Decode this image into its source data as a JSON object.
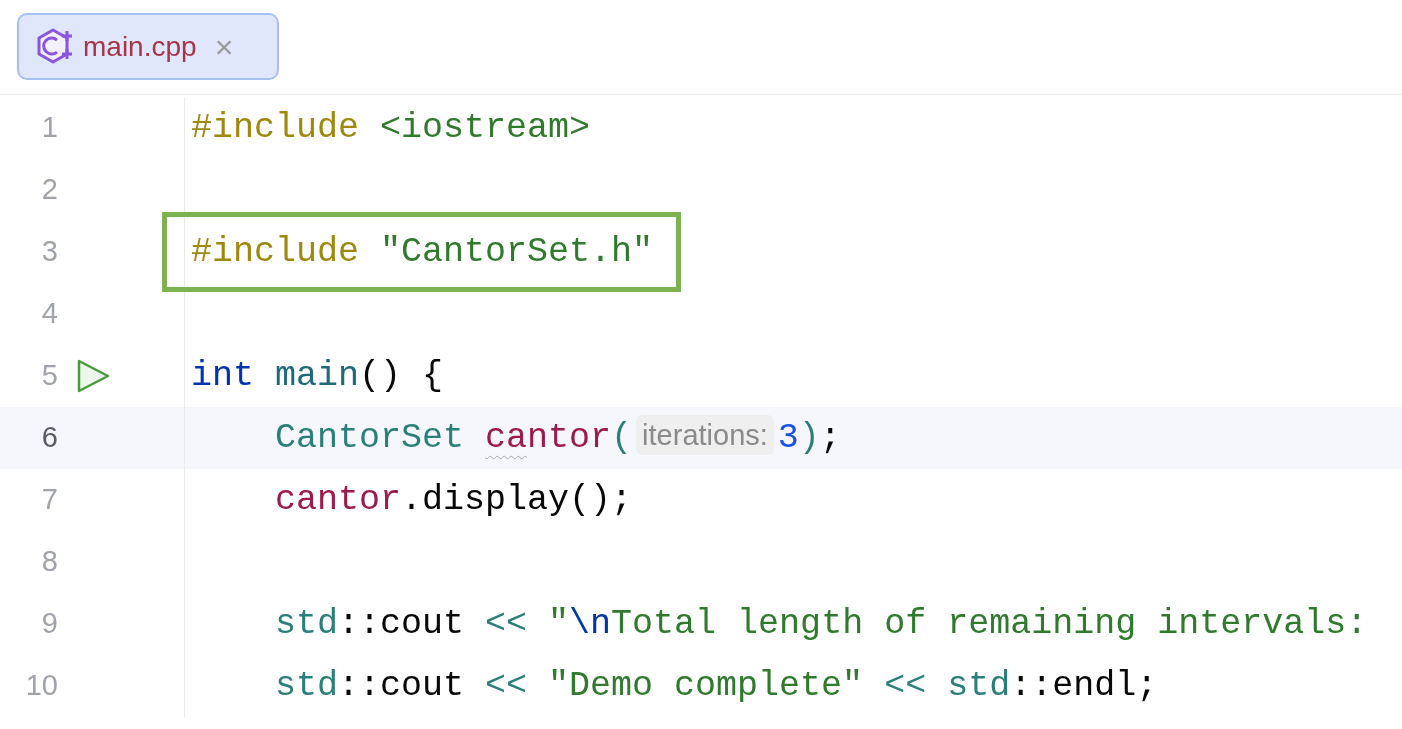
{
  "tab": {
    "label": "main.cpp",
    "close": "×",
    "selected": true
  },
  "lines": [
    {
      "number": "1",
      "current": false,
      "run": false,
      "boxed": false,
      "indented": false,
      "tokens": [
        {
          "text": "#include ",
          "kind": "directive"
        },
        {
          "text": "<iostream>",
          "kind": "string"
        }
      ]
    },
    {
      "number": "2",
      "current": false,
      "run": false,
      "boxed": false
    },
    {
      "number": "3",
      "current": false,
      "run": false,
      "boxed": true,
      "indented": false,
      "tokens": [
        {
          "text": "#include ",
          "kind": "directive"
        },
        {
          "text": "\"CantorSet.h\"",
          "kind": "string"
        }
      ]
    },
    {
      "number": "4",
      "current": false,
      "run": false,
      "boxed": false
    },
    {
      "number": "5",
      "current": false,
      "run": true,
      "boxed": false,
      "indented": false,
      "tokens": [
        {
          "text": "int ",
          "kind": "keyword"
        },
        {
          "text": "main",
          "kind": "function"
        },
        {
          "text": "() {",
          "kind": "plain"
        }
      ]
    },
    {
      "number": "6",
      "current": true,
      "run": false,
      "boxed": false,
      "indented": true,
      "tokens": [
        {
          "text": "CantorSet ",
          "kind": "type"
        },
        {
          "text": "ca",
          "kind": "warning_variable"
        },
        {
          "text": "ntor",
          "kind": "variable"
        },
        {
          "text": "(",
          "kind": "type"
        },
        {
          "text": "iterations:",
          "kind": "hint"
        },
        {
          "text": "3",
          "kind": "number"
        },
        {
          "text": ")",
          "kind": "type"
        },
        {
          "text": ";",
          "kind": "plain"
        }
      ]
    },
    {
      "number": "7",
      "current": false,
      "run": false,
      "boxed": false,
      "indented": true,
      "tokens": [
        {
          "text": "cantor",
          "kind": "variable"
        },
        {
          "text": ".display();",
          "kind": "plain"
        }
      ]
    },
    {
      "number": "8",
      "current": false,
      "run": false,
      "boxed": false
    },
    {
      "number": "9",
      "current": false,
      "run": false,
      "boxed": false,
      "indented": true,
      "tokens": [
        {
          "text": "std",
          "kind": "type"
        },
        {
          "text": "::cout ",
          "kind": "plain"
        },
        {
          "text": "<< ",
          "kind": "type"
        },
        {
          "text": "\"",
          "kind": "string"
        },
        {
          "text": "\\n",
          "kind": "escape"
        },
        {
          "text": "Total length of remaining intervals:",
          "kind": "string"
        }
      ]
    },
    {
      "number": "10",
      "current": false,
      "run": false,
      "boxed": false,
      "indented": true,
      "tokens": [
        {
          "text": "std",
          "kind": "type"
        },
        {
          "text": "::cout ",
          "kind": "plain"
        },
        {
          "text": "<< ",
          "kind": "type"
        },
        {
          "text": "\"Demo complete\" ",
          "kind": "string"
        },
        {
          "text": "<< ",
          "kind": "type"
        },
        {
          "text": "std",
          "kind": "type"
        },
        {
          "text": "::endl;",
          "kind": "plain"
        }
      ]
    }
  ]
}
